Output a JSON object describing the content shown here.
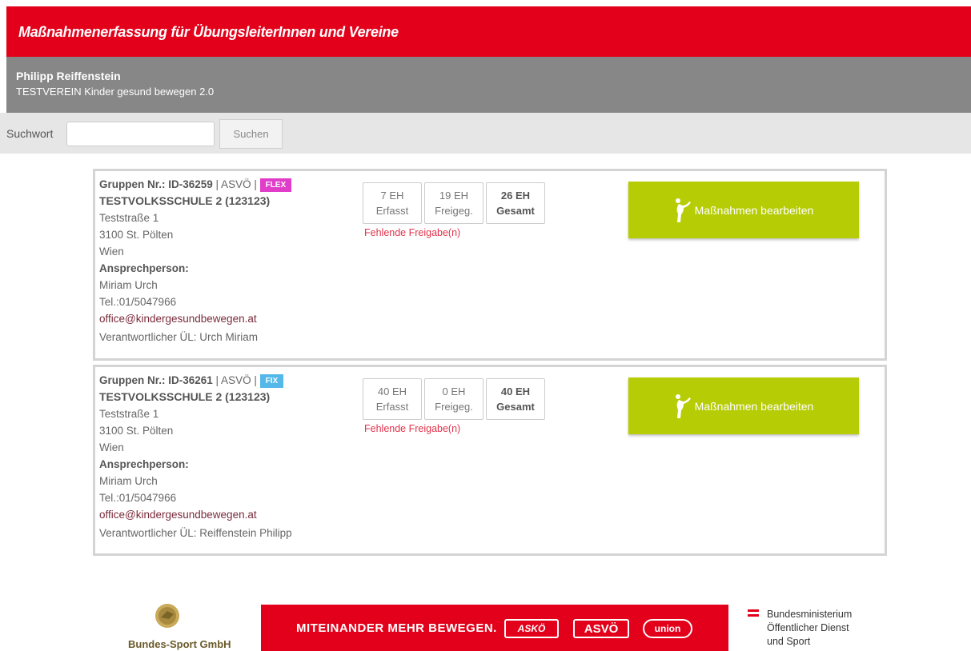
{
  "header": {
    "title": "Maßnahmenerfassung für ÜbungsleiterInnen und Vereine"
  },
  "user": {
    "name": "Philipp Reiffenstein",
    "club": "TESTVEREIN Kinder gesund bewegen 2.0"
  },
  "search": {
    "label": "Suchwort",
    "value": "",
    "button": "Suchen"
  },
  "groups": [
    {
      "group_label": "Gruppen Nr.: ID-36259",
      "org": " | ASVÖ | ",
      "type": "FLEX",
      "school": "TESTVOLKSSCHULE 2 (123123)",
      "street": "Teststraße 1",
      "city": "3100 St. Pölten",
      "state": "Wien",
      "contact_heading": "Ansprechperson:",
      "contact_name": "Miriam Urch",
      "contact_phone": "Tel.:01/5047966",
      "contact_email": "office@kindergesundbewegen.at",
      "responsible": "Verantwortlicher ÜL: Urch Miriam",
      "stats": {
        "captured": "7 EH",
        "captured_label": "Erfasst",
        "released": "19 EH",
        "released_label": "Freigeg.",
        "total": "26 EH",
        "total_label": "Gesamt"
      },
      "warning": "Fehlende Freigabe(n)",
      "action": "Maßnahmen bearbeiten"
    },
    {
      "group_label": "Gruppen Nr.: ID-36261",
      "org": " | ASVÖ | ",
      "type": "FIX",
      "school": "TESTVOLKSSCHULE 2 (123123)",
      "street": "Teststraße 1",
      "city": "3100 St. Pölten",
      "state": "Wien",
      "contact_heading": "Ansprechperson:",
      "contact_name": "Miriam Urch",
      "contact_phone": "Tel.:01/5047966",
      "contact_email": "office@kindergesundbewegen.at",
      "responsible": "Verantwortlicher ÜL: Reiffenstein Philipp",
      "stats": {
        "captured": "40 EH",
        "captured_label": "Erfasst",
        "released": "0 EH",
        "released_label": "Freigeg.",
        "total": "40 EH",
        "total_label": "Gesamt"
      },
      "warning": "Fehlende Freigabe(n)",
      "action": "Maßnahmen bearbeiten"
    }
  ],
  "footer": {
    "sport_gmbh": "Bundes-Sport GmbH",
    "slogan": "MITEINANDER MEHR BEWEGEN.",
    "partners": [
      "ASKÖ",
      "ASVÖ",
      "union"
    ],
    "ministry_line1": "Bundesministerium",
    "ministry_line2": "Öffentlicher Dienst",
    "ministry_line3": "und Sport"
  },
  "colors": {
    "brand_red": "#e2001a",
    "action_green": "#b6cc05",
    "flex_badge": "#e03dc8",
    "fix_badge": "#54b8e8",
    "warning": "#e2334b"
  },
  "icons": {
    "action": "exercise-figure-icon",
    "logo": "bundes-sport-logo-icon",
    "flag": "austria-flag-icon"
  }
}
